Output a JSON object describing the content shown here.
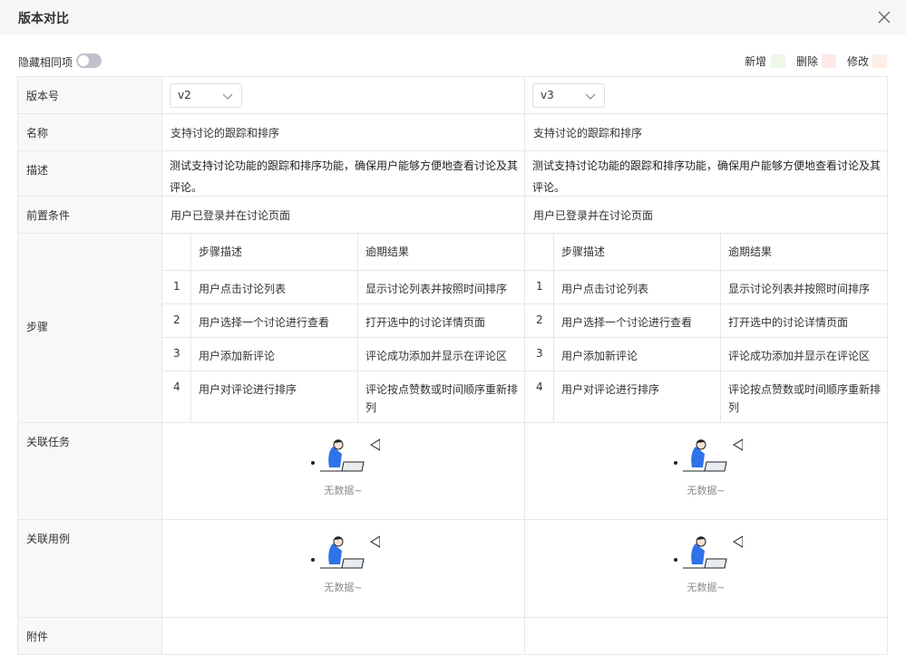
{
  "header": {
    "title": "版本对比"
  },
  "toolbar": {
    "hide_same_label": "隐藏相同项",
    "legend": {
      "added": "新增",
      "deleted": "删除",
      "modified": "修改"
    },
    "colors": {
      "added": "#eef8ea",
      "deleted": "#fde9e8",
      "modified": "#fdeee6"
    }
  },
  "rows": {
    "version": "版本号",
    "name": "名称",
    "description": "描述",
    "precondition": "前置条件",
    "steps": "步骤",
    "related_tasks": "关联任务",
    "related_cases": "关联用例",
    "attachments": "附件"
  },
  "left": {
    "version": "v2",
    "name": "支持讨论的跟踪和排序",
    "description": "测试支持讨论功能的跟踪和排序功能，确保用户能够方便地查看讨论及其评论。",
    "precondition": "用户已登录并在讨论页面",
    "steps_headers": {
      "desc": "步骤描述",
      "result": "逾期结果"
    },
    "steps": [
      {
        "n": "1",
        "desc": "用户点击讨论列表",
        "result": "显示讨论列表并按照时间排序"
      },
      {
        "n": "2",
        "desc": "用户选择一个讨论进行查看",
        "result": "打开选中的讨论详情页面"
      },
      {
        "n": "3",
        "desc": "用户添加新评论",
        "result": "评论成功添加并显示在评论区"
      },
      {
        "n": "4",
        "desc": "用户对评论进行排序",
        "result": "评论按点赞数或时间顺序重新排列"
      }
    ],
    "empty_tasks": "无数据~",
    "empty_cases": "无数据~"
  },
  "right": {
    "version": "v3",
    "name": "支持讨论的跟踪和排序",
    "description": "测试支持讨论功能的跟踪和排序功能，确保用户能够方便地查看讨论及其评论。",
    "precondition": "用户已登录并在讨论页面",
    "steps_headers": {
      "desc": "步骤描述",
      "result": "逾期结果"
    },
    "steps": [
      {
        "n": "1",
        "desc": "用户点击讨论列表",
        "result": "显示讨论列表并按照时间排序"
      },
      {
        "n": "2",
        "desc": "用户选择一个讨论进行查看",
        "result": "打开选中的讨论详情页面"
      },
      {
        "n": "3",
        "desc": "用户添加新评论",
        "result": "评论成功添加并显示在评论区"
      },
      {
        "n": "4",
        "desc": "用户对评论进行排序",
        "result": "评论按点赞数或时间顺序重新排列"
      }
    ],
    "empty_tasks": "无数据~",
    "empty_cases": "无数据~"
  },
  "icons": {
    "close": "close-icon",
    "select": "chevron-down-icon",
    "empty": "empty-illustration"
  },
  "hide_same_on": false
}
